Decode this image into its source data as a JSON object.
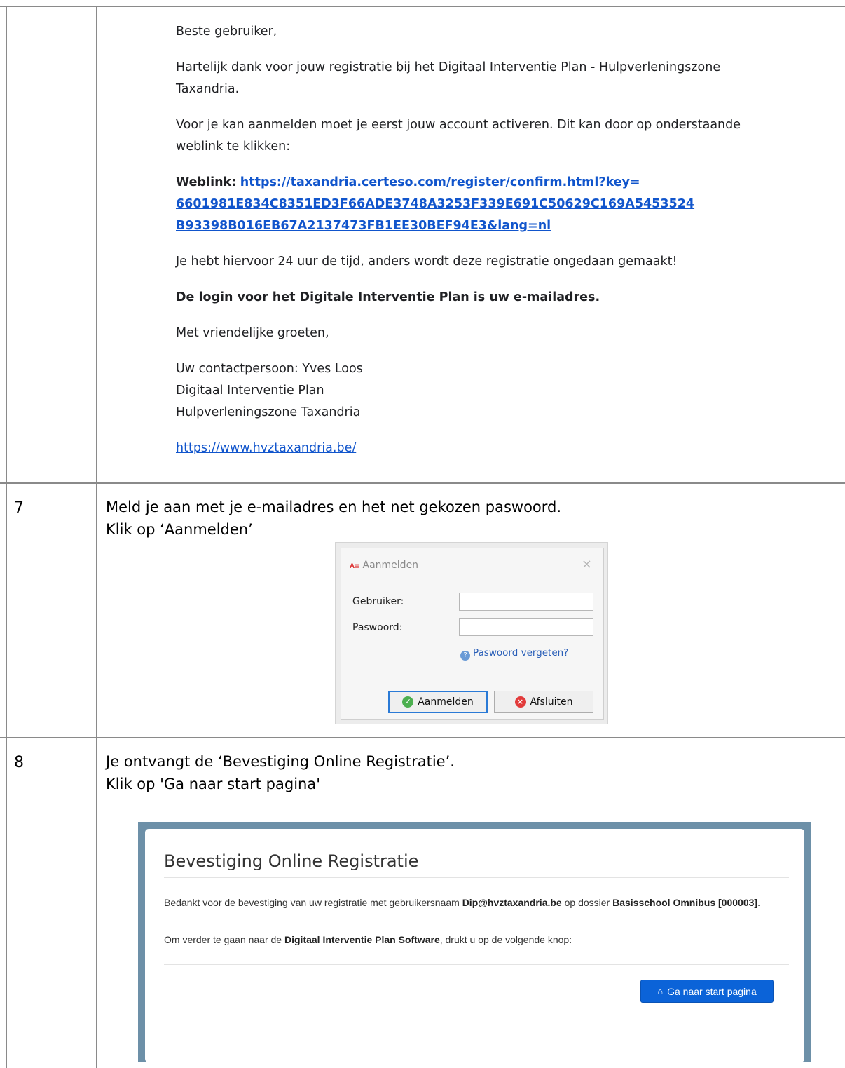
{
  "email": {
    "greeting": "Beste gebruiker,",
    "thanks": "Hartelijk dank voor jouw registratie bij het Digitaal Interventie Plan - Hulpverleningszone Taxandria.",
    "activate": "Voor je kan aanmelden moet je eerst jouw account activeren. Dit kan door op onderstaande weblink te klikken:",
    "weblink_label": "Weblink:",
    "weblink_lines": [
      "https://taxandria.certeso.com/register/confirm.html?key=",
      "6601981E834C8351ED3F66ADE3748A3253F339E691C50629C169A5453524",
      "B93398B016EB67A2137473FB1EE30BEF94E3&lang=nl"
    ],
    "time_limit": "Je hebt hiervoor 24 uur de tijd, anders wordt deze registratie ongedaan gemaakt!",
    "login_note": "De login voor het Digitale Interventie Plan is uw e-mailadres.",
    "closing": "Met vriendelijke groeten,",
    "contact_lines": [
      "Uw contactpersoon: Yves Loos",
      "Digitaal Interventie Plan",
      "Hulpverleningszone Taxandria"
    ],
    "website": "https://www.hvztaxandria.be/"
  },
  "steps": [
    {
      "number": "7",
      "lines": [
        "Meld je aan met je e-mailadres en het net gekozen paswoord.",
        "Klik op ‘Aanmelden’"
      ]
    },
    {
      "number": "8",
      "lines": [
        "Je ontvangt de ‘Bevestiging Online Registratie’.",
        "Klik op 'Ga naar start pagina'"
      ]
    }
  ],
  "login_dialog": {
    "logo": "A≡",
    "title": "Aanmelden",
    "user_label": "Gebruiker:",
    "password_label": "Paswoord:",
    "user_value": "",
    "password_value": "",
    "forgot": "Paswoord vergeten?",
    "login_button": "Aanmelden",
    "close_button": "Afsluiten"
  },
  "confirmation": {
    "title": "Bevestiging Online Registratie",
    "text1_a": "Bedankt voor de bevestiging van uw registratie met gebruikersnaam ",
    "username": "Dip@hvztaxandria.be",
    "text1_b": " op dossier ",
    "dossier": "Basisschool Omnibus [000003]",
    "text1_c": ".",
    "text2_a": "Om verder te gaan naar de ",
    "software": "Digitaal Interventie Plan Software",
    "text2_b": ", drukt u op de volgende knop:",
    "button": "Ga naar start pagina"
  }
}
